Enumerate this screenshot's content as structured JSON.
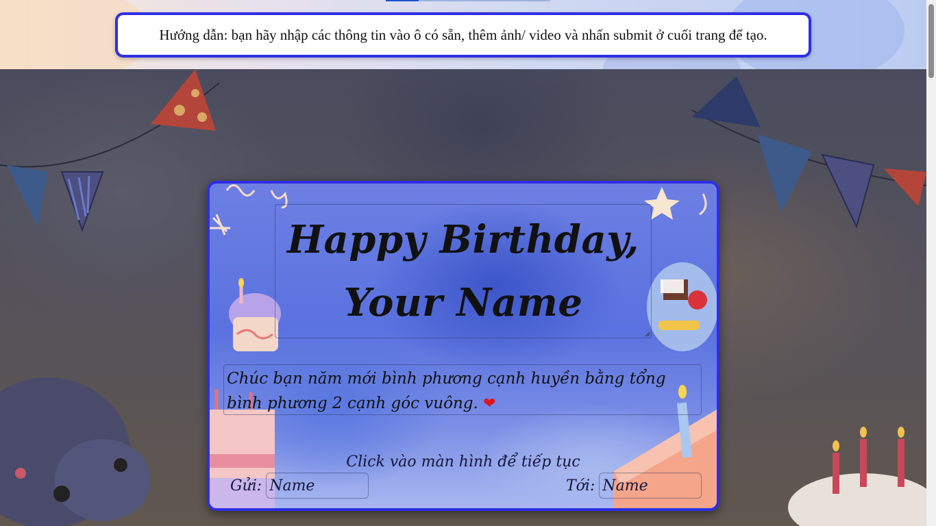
{
  "instruction": {
    "text": "Hướng dẫn: bạn hãy nhập các thông tin vào ô có sẵn, thêm ảnh/ video và nhấn submit ở cuối trang để tạo."
  },
  "card": {
    "title_line1": "Happy Birthday,",
    "title_line2": "Your Name",
    "message": "Chúc bạn năm mới bình phương cạnh huyền bằng tổng bình phương 2 cạnh góc vuông.",
    "message_emoji": "❤",
    "continue_hint": "Click vào màn hình để tiếp tục",
    "sender_label": "Gửi:",
    "sender_value": "Name",
    "recipient_label": "Tới:",
    "recipient_value": "Name"
  },
  "colors": {
    "accent_border": "#2e2ee6",
    "card_blue": "#6d7fe3",
    "heart": "#e0141e"
  }
}
